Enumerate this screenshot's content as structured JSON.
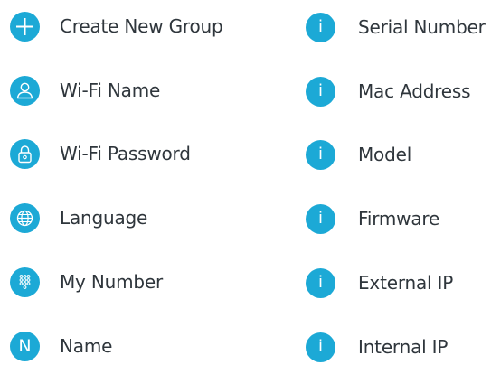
{
  "colors": {
    "accent": "#1ca9d6",
    "text": "#2f363c",
    "background": "#ffffff"
  },
  "left_menu": [
    {
      "label": "Create New Group",
      "icon": "plus-icon"
    },
    {
      "label": "Wi-Fi Name",
      "icon": "user-icon"
    },
    {
      "label": "Wi-Fi Password",
      "icon": "lock-icon"
    },
    {
      "label": "Language",
      "icon": "globe-icon"
    },
    {
      "label": "My Number",
      "icon": "keypad-icon"
    },
    {
      "label": "Name",
      "icon": "letter-n-icon",
      "glyph": "N"
    }
  ],
  "right_menu": [
    {
      "label": "Serial Number",
      "icon": "info-icon",
      "glyph": "i"
    },
    {
      "label": "Mac Address",
      "icon": "info-icon",
      "glyph": "i"
    },
    {
      "label": "Model",
      "icon": "info-icon",
      "glyph": "i"
    },
    {
      "label": "Firmware",
      "icon": "info-icon",
      "glyph": "i"
    },
    {
      "label": "External IP",
      "icon": "info-icon",
      "glyph": "i"
    },
    {
      "label": "Internal IP",
      "icon": "info-icon",
      "glyph": "i"
    }
  ]
}
